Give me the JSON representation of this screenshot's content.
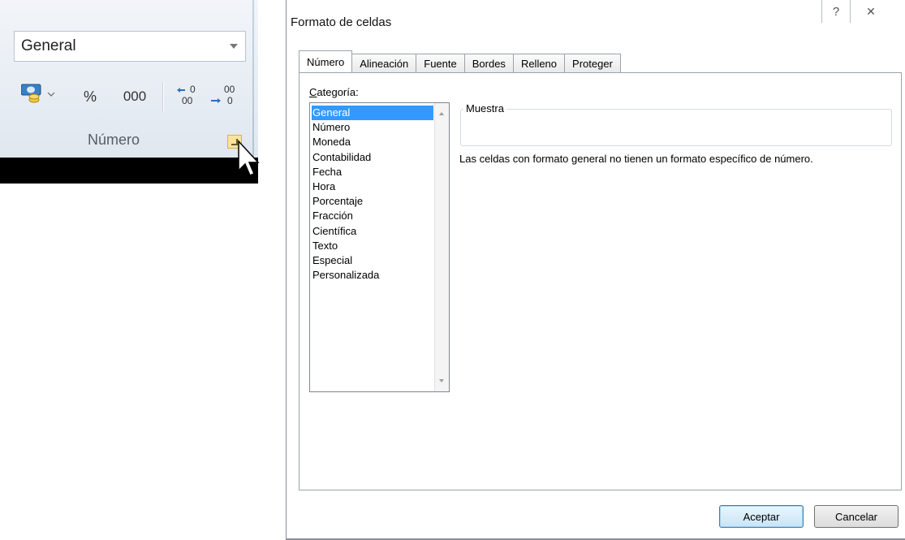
{
  "ribbon": {
    "number_format_value": "General",
    "percent_label": "%",
    "thousands_label": "000",
    "increase_decimal_label": "←,0 / ,00",
    "decrease_decimal_label": ",00 → ,0",
    "group_label": "Número"
  },
  "dialog": {
    "title": "Formato de celdas",
    "help_glyph": "?",
    "close_glyph": "✕",
    "tabs": [
      {
        "label": "Número",
        "active": true
      },
      {
        "label": "Alineación",
        "active": false
      },
      {
        "label": "Fuente",
        "active": false
      },
      {
        "label": "Bordes",
        "active": false
      },
      {
        "label": "Relleno",
        "active": false
      },
      {
        "label": "Proteger",
        "active": false
      }
    ],
    "category_label_underlined": "C",
    "category_label_rest": "ategoría:",
    "categories": [
      "General",
      "Número",
      "Moneda",
      "Contabilidad",
      "Fecha",
      "Hora",
      "Porcentaje",
      "Fracción",
      "Científica",
      "Texto",
      "Especial",
      "Personalizada"
    ],
    "selected_category": "General",
    "sample_label": "Muestra",
    "description": "Las celdas con formato general no tienen un formato específico de número.",
    "ok_label": "Aceptar",
    "cancel_label": "Cancelar"
  },
  "colors": {
    "selection": "#3399ff",
    "launcher": "#fbe39a"
  }
}
